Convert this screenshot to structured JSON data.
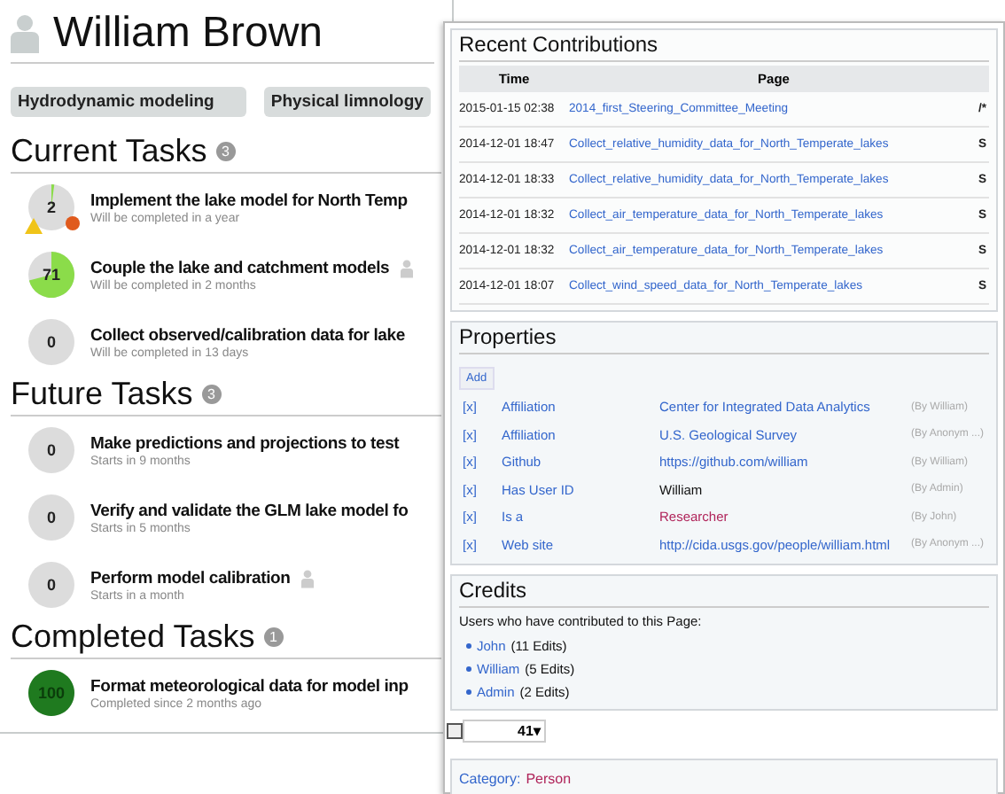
{
  "profile": {
    "name": "William Brown",
    "tags": [
      "Hydrodynamic modeling",
      "Physical limnology"
    ]
  },
  "task_sections": [
    {
      "title": "Current Tasks",
      "count": "3",
      "kind": "current",
      "tasks": [
        {
          "progress": "2",
          "title": "Implement the lake model for North Temp",
          "subtitle": "Will be completed in a year",
          "flagged": true,
          "assignee_icon": false
        },
        {
          "progress": "71",
          "title": "Couple the lake and catchment models",
          "subtitle": "Will be completed in 2 months",
          "flagged": false,
          "assignee_icon": true
        },
        {
          "progress": "0",
          "title": "Collect observed/calibration data for lake",
          "subtitle": "Will be completed in 13 days",
          "flagged": false,
          "assignee_icon": false
        }
      ]
    },
    {
      "title": "Future Tasks",
      "count": "3",
      "kind": "future",
      "tasks": [
        {
          "progress": "0",
          "title": "Make predictions and projections to test",
          "subtitle": "Starts in 9 months",
          "flagged": false,
          "assignee_icon": false
        },
        {
          "progress": "0",
          "title": "Verify and validate the GLM lake model fo",
          "subtitle": "Starts in 5 months",
          "flagged": false,
          "assignee_icon": false
        },
        {
          "progress": "0",
          "title": "Perform model calibration",
          "subtitle": "Starts in a month",
          "flagged": false,
          "assignee_icon": true
        }
      ]
    },
    {
      "title": "Completed Tasks",
      "count": "1",
      "kind": "completed",
      "tasks": [
        {
          "progress": "100",
          "title": "Format meteorological data for model inp",
          "subtitle": "Completed since 2 months ago",
          "flagged": false,
          "assignee_icon": false
        }
      ]
    }
  ],
  "recent_contributions": {
    "title": "Recent Contributions",
    "columns": [
      "Time",
      "Page"
    ],
    "rows": [
      {
        "time": "2015-01-15 02:38",
        "page": "2014_first_Steering_Committee_Meeting",
        "column_3": "/*"
      },
      {
        "time": "2014-12-01 18:47",
        "page": "Collect_relative_humidity_data_for_North_Temperate_lakes",
        "column_3": "S"
      },
      {
        "time": "2014-12-01 18:33",
        "page": "Collect_relative_humidity_data_for_North_Temperate_lakes",
        "column_3": "S"
      },
      {
        "time": "2014-12-01 18:32",
        "page": "Collect_air_temperature_data_for_North_Temperate_lakes",
        "column_3": "S"
      },
      {
        "time": "2014-12-01 18:32",
        "page": "Collect_air_temperature_data_for_North_Temperate_lakes",
        "column_3": "S"
      },
      {
        "time": "2014-12-01 18:07",
        "page": "Collect_wind_speed_data_for_North_Temperate_lakes",
        "column_3": "S"
      }
    ]
  },
  "properties": {
    "title": "Properties",
    "add_label": "Add",
    "rows": [
      {
        "remove": "[x]",
        "property": "Affiliation",
        "value": "Center for Integrated Data Analytics",
        "kind": "link",
        "by": "(By William)"
      },
      {
        "remove": "[x]",
        "property": "Affiliation",
        "value": "U.S. Geological Survey",
        "kind": "link",
        "by": "(By Anonym ...)"
      },
      {
        "remove": "[x]",
        "property": "Github",
        "value": "https://github.com/william",
        "kind": "link",
        "by": "(By William)"
      },
      {
        "remove": "[x]",
        "property": "Has User ID",
        "value": "William",
        "kind": "plain",
        "by": "(By Admin)"
      },
      {
        "remove": "[x]",
        "property": "Is a",
        "value": "Researcher",
        "kind": "category",
        "by": "(By John)"
      },
      {
        "remove": "[x]",
        "property": "Web site",
        "value": "http://cida.usgs.gov/people/william.html",
        "kind": "link",
        "by": "(By Anonym ...)"
      }
    ]
  },
  "credits": {
    "title": "Credits",
    "intro": "Users who have contributed to this Page:",
    "users": [
      {
        "name": "John",
        "edits": "(11 Edits)"
      },
      {
        "name": "William",
        "edits": "(5 Edits)"
      },
      {
        "name": "Admin",
        "edits": "(2 Edits)"
      }
    ]
  },
  "counter": {
    "value": "41▾"
  },
  "category": {
    "label": "Category:",
    "value": "Person"
  }
}
